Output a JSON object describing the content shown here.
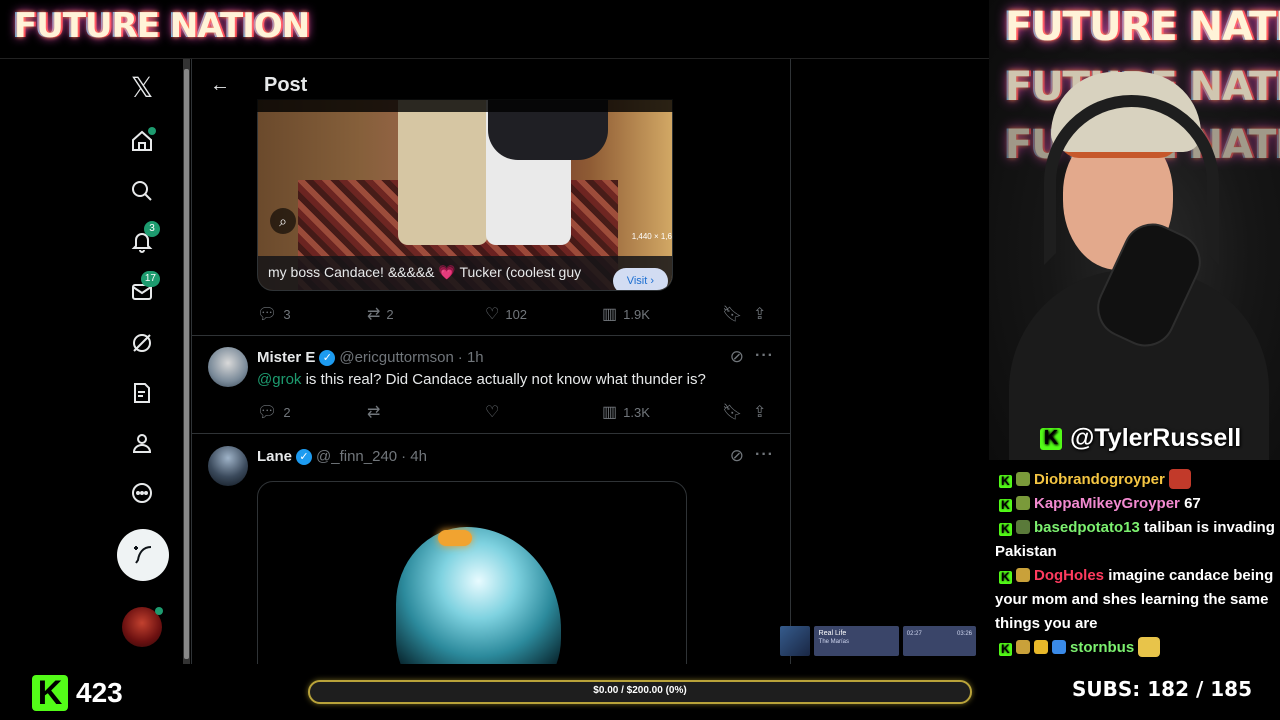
{
  "overlay": {
    "brand": "FUTURE NATION",
    "handle": "@TylerRussell",
    "kick_count": "423",
    "goal_text": "$0.00 / $200.00 (0%)",
    "goal_progress_pct": 0,
    "subs_label": "SUBS:",
    "subs_value": "182 / 185",
    "music": {
      "title": "Real Life",
      "artist": "The Marías",
      "elapsed": "02:27",
      "total": "03:26"
    },
    "kick_letter": "K"
  },
  "chat": [
    {
      "user": "Diobrandogroyper",
      "color": "#f4c542",
      "text": ""
    },
    {
      "user": "KappaMikeyGroyper",
      "color": "#f28ad0",
      "text": "67"
    },
    {
      "user": "basedpotato13",
      "color": "#7cf06f",
      "text": "taliban is invading Pakistan"
    },
    {
      "user": "DogHoles",
      "color": "#ff3b5f",
      "text": "imagine candace being your mom and shes learning the same things you are"
    },
    {
      "user": "stornbus",
      "color": "#7cf06f",
      "text": ""
    }
  ],
  "nav": {
    "notifications_badge": "3",
    "messages_badge": "17",
    "logo_glyph": "𝕏"
  },
  "header": {
    "title": "Post",
    "back_glyph": "←"
  },
  "post1": {
    "caption": "my boss Candace! &&&&& 💗 Tucker (coolest guy",
    "visit": "Visit ›",
    "resolution": "1,440 × 1,6",
    "replies": "3",
    "reposts": "2",
    "likes": "102",
    "views": "1.9K"
  },
  "reply1": {
    "name": "Mister E",
    "handle": "@ericguttormson",
    "time": "· 1h",
    "mention": "@grok",
    "text": " is this real? Did Candace actually not know what thunder is?",
    "replies": "2",
    "views": "1.3K"
  },
  "reply2": {
    "name": "Lane",
    "handle": "@_finn_240",
    "time": "· 4h"
  },
  "colors": {
    "accent_kick": "#53fc18",
    "x_bg": "#000000",
    "verified": "#1d9bf0"
  }
}
